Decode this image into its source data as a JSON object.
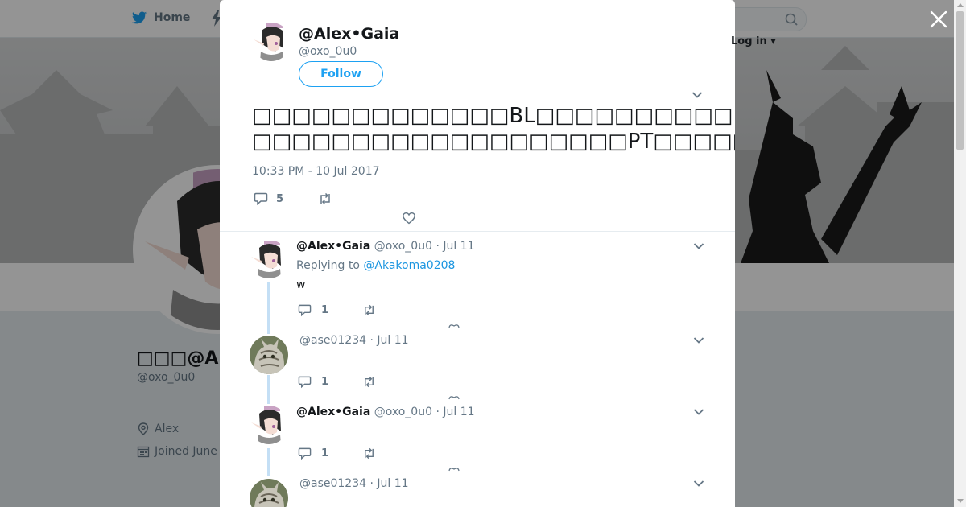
{
  "background": {
    "nav": {
      "home_label": "Home",
      "login_label": "Log in"
    },
    "profile": {
      "display_name_visible": "□□□@Alex",
      "handle": "@oxo_0u0",
      "location": "Alex",
      "joined": "Joined June"
    }
  },
  "modal": {
    "author": {
      "display_name": "@Alex•Gaia",
      "handle": "@oxo_0u0"
    },
    "follow_label": "Follow",
    "tweet": {
      "line1": "□□□□□□□□□□□□□BL□□□□□□□□□□",
      "line2": "□□□□□□□□□□□□□□□□□□□PT□□□□□□□□□□□□□□□□□",
      "timestamp": "10:33 PM - 10 Jul 2017",
      "reply_count": "5"
    },
    "replies": [
      {
        "display_name": "@Alex•Gaia",
        "handle": "@oxo_0u0",
        "sep": "·",
        "date": "Jul 11",
        "replying_prefix": "Replying to",
        "replying_mention": "@Akakoma0208",
        "text": "w",
        "reply_count": "1"
      },
      {
        "display_name": "",
        "handle": "@ase01234",
        "sep": "·",
        "date": "Jul 11",
        "reply_count": "1"
      },
      {
        "display_name": "@Alex•Gaia",
        "handle": "@oxo_0u0",
        "sep": "·",
        "date": "Jul 11",
        "reply_count": "1"
      },
      {
        "display_name": "",
        "handle": "@ase01234",
        "sep": "·",
        "date": "Jul 11"
      }
    ]
  },
  "icons": {
    "brand": "twitter-bird-icon",
    "close": "close-x-icon",
    "reply": "speech-bubble-icon",
    "retweet": "retweet-arrows-icon",
    "like": "heart-icon",
    "caret": "chevron-down-icon",
    "search": "magnifier-icon",
    "location": "map-pin-icon",
    "calendar": "calendar-icon"
  },
  "colors": {
    "brand_blue": "#1da1f2",
    "link_blue": "#1b95e0",
    "text_primary": "#14171a",
    "text_secondary": "#657786",
    "thread_line": "#c4dff5"
  }
}
